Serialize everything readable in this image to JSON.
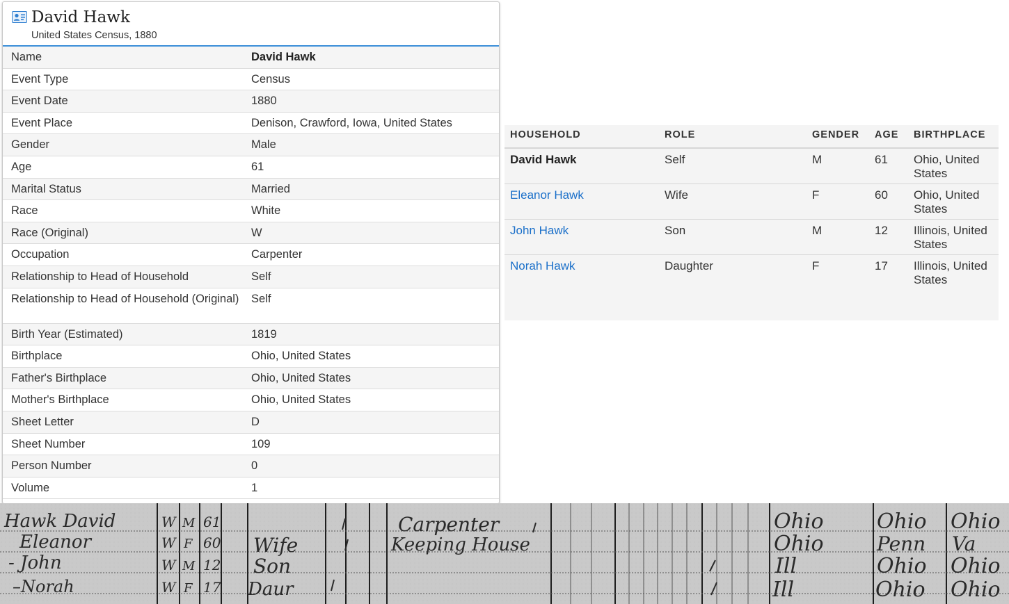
{
  "record": {
    "title": "David Hawk",
    "subtitle": "United States Census, 1880",
    "icon": "person-card-icon",
    "fields": [
      {
        "label": "Name",
        "value": "David Hawk"
      },
      {
        "label": "Event Type",
        "value": "Census"
      },
      {
        "label": "Event Date",
        "value": "1880"
      },
      {
        "label": "Event Place",
        "value": "Denison, Crawford, Iowa, United States"
      },
      {
        "label": "Gender",
        "value": "Male"
      },
      {
        "label": "Age",
        "value": "61"
      },
      {
        "label": "Marital Status",
        "value": "Married"
      },
      {
        "label": "Race",
        "value": "White"
      },
      {
        "label": "Race (Original)",
        "value": "W"
      },
      {
        "label": "Occupation",
        "value": "Carpenter"
      },
      {
        "label": "Relationship to Head of Household",
        "value": "Self"
      },
      {
        "label": "Relationship to Head of Household (Original)",
        "value": "Self"
      },
      {
        "label": "Birth Year (Estimated)",
        "value": "1819"
      },
      {
        "label": "Birthplace",
        "value": "Ohio, United States"
      },
      {
        "label": "Father's Birthplace",
        "value": "Ohio, United States"
      },
      {
        "label": "Mother's Birthplace",
        "value": "Ohio, United States"
      },
      {
        "label": "Sheet Letter",
        "value": "D"
      },
      {
        "label": "Sheet Number",
        "value": "109"
      },
      {
        "label": "Person Number",
        "value": "0"
      },
      {
        "label": "Volume",
        "value": "1"
      }
    ]
  },
  "household": {
    "headers": {
      "household": "HOUSEHOLD",
      "role": "ROLE",
      "gender": "GENDER",
      "age": "AGE",
      "birthplace": "BIRTHPLACE"
    },
    "members": [
      {
        "name": "David Hawk",
        "role": "Self",
        "gender": "M",
        "age": "61",
        "birthplace": "Ohio, United States"
      },
      {
        "name": "Eleanor Hawk",
        "role": "Wife",
        "gender": "F",
        "age": "60",
        "birthplace": "Ohio, United States"
      },
      {
        "name": "John Hawk",
        "role": "Son",
        "gender": "M",
        "age": "12",
        "birthplace": "Illinois, United States"
      },
      {
        "name": "Norah Hawk",
        "role": "Daughter",
        "gender": "F",
        "age": "17",
        "birthplace": "Illinois, United States"
      }
    ]
  },
  "colors": {
    "accent": "#3c8fd9",
    "link": "#1a6fc9",
    "scan_background": "#c9c9c9"
  }
}
